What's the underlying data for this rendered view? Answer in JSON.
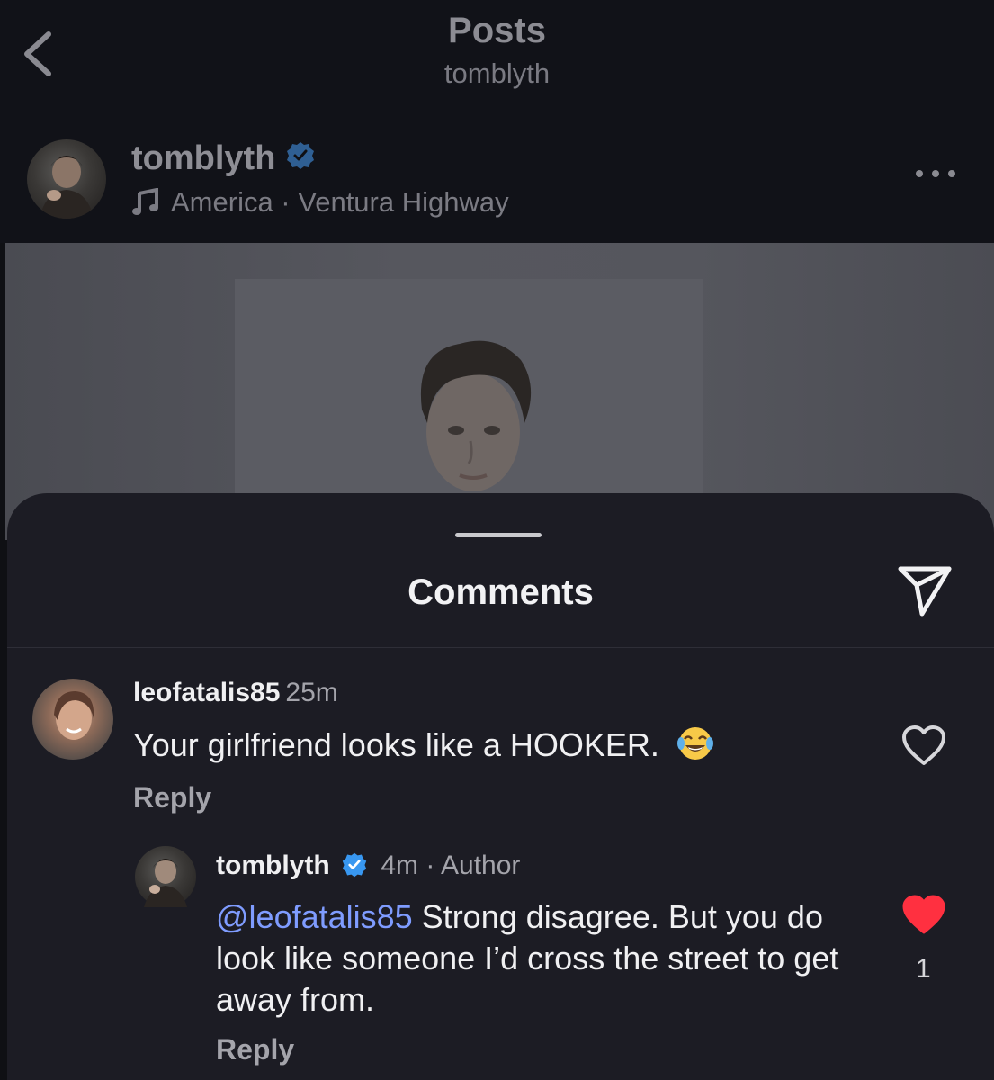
{
  "header": {
    "title": "Posts",
    "subtitle": "tomblyth"
  },
  "post": {
    "username": "tomblyth",
    "verified": true,
    "music": "America · Ventura Highway"
  },
  "comments_sheet": {
    "title": "Comments",
    "comments": [
      {
        "username": "leofatalis85",
        "time": "25m",
        "text": "Your girlfriend looks like a HOOKER.",
        "emoji": "😂",
        "reply_label": "Reply",
        "liked": false
      },
      {
        "username": "tomblyth",
        "verified": true,
        "time_author": "4m · Author",
        "mention": "@leofatalis85",
        "text": " Strong disagree. But you do look like someone I’d cross the street to get away from.",
        "reply_label": "Reply",
        "liked": true,
        "like_count": "1"
      }
    ]
  },
  "icons": {
    "back": "chevron-left-icon",
    "verified": "verified-badge-icon",
    "music": "music-note-icon",
    "more": "more-options-icon",
    "share": "paper-plane-icon",
    "like": "heart-icon"
  },
  "colors": {
    "sheet_background": "#1c1c24",
    "mention": "#7f9cff",
    "verified": "#3897f0",
    "liked_heart": "#ff3040"
  }
}
